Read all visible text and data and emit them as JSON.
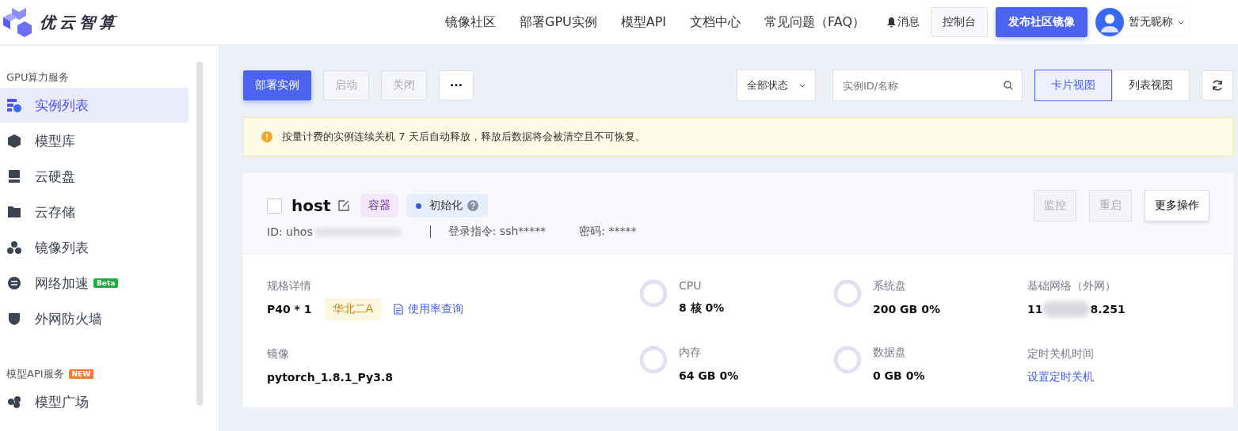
{
  "header": {
    "brand": "优云智算",
    "nav": [
      {
        "label": "镜像社区"
      },
      {
        "label": "部署GPU实例"
      },
      {
        "label": "模型API"
      },
      {
        "label": "文档中心"
      },
      {
        "label": "常见问题（FAQ）"
      }
    ],
    "messages": "消息",
    "console": "控制台",
    "publish": "发布社区镜像",
    "user": "暂无昵称"
  },
  "sidebar": {
    "sections": [
      {
        "title": "GPU算力服务",
        "items": [
          {
            "label": "实例列表",
            "selected": true
          },
          {
            "label": "模型库",
            "selected": false
          },
          {
            "label": "云硬盘",
            "selected": false
          },
          {
            "label": "云存储",
            "selected": false
          },
          {
            "label": "镜像列表",
            "selected": false
          },
          {
            "label": "网络加速",
            "selected": false,
            "badge": "Beta"
          },
          {
            "label": "外网防火墙",
            "selected": false
          }
        ]
      },
      {
        "title": "模型API服务",
        "badge": "NEW",
        "items": [
          {
            "label": "模型广场",
            "selected": false
          }
        ]
      }
    ]
  },
  "toolbar": {
    "deploy": "部署实例",
    "start": "启动",
    "stop": "关闭",
    "more": "···",
    "status_filter": "全部状态",
    "search": {
      "placeholder": "实例ID/名称"
    },
    "views": [
      {
        "label": "卡片视图",
        "selected": true
      },
      {
        "label": "列表视图",
        "selected": false
      }
    ]
  },
  "notice": "按量计费的实例连续关机 7 天后自动释放，释放后数据将会被清空且不可恢复。",
  "instance": {
    "checked": false,
    "name": "host",
    "type_tag": "容器",
    "status": "初始化",
    "id": "ID: uhos",
    "login": "登录指令: ssh*****",
    "password": "密码: *****",
    "actions": [
      {
        "label": "监控",
        "disabled": true
      },
      {
        "label": "重启",
        "disabled": true
      },
      {
        "label": "更多操作",
        "disabled": false
      }
    ],
    "spec_label": "规格详情",
    "spec": "P40 * 1",
    "region": "华北二A",
    "usage_link": "使用率查询",
    "image_label": "镜像",
    "image": "pytorch_1.8.1_Py3.8",
    "metrics": [
      {
        "label": "CPU",
        "value": "8 核 0%",
        "level": 0
      },
      {
        "label": "系统盘",
        "value": "200 GB 0%",
        "level": 0
      },
      {
        "label": "内存",
        "value": "64 GB 0%",
        "level": 0
      },
      {
        "label": "数据盘",
        "value": "0 GB 0%",
        "level": 0
      }
    ],
    "network_label": "基础网络（外网）",
    "ip_parts": [
      "11",
      "8.251"
    ],
    "shutdown_label": "定时关机时间",
    "shutdown_link": "设置定时关机"
  }
}
